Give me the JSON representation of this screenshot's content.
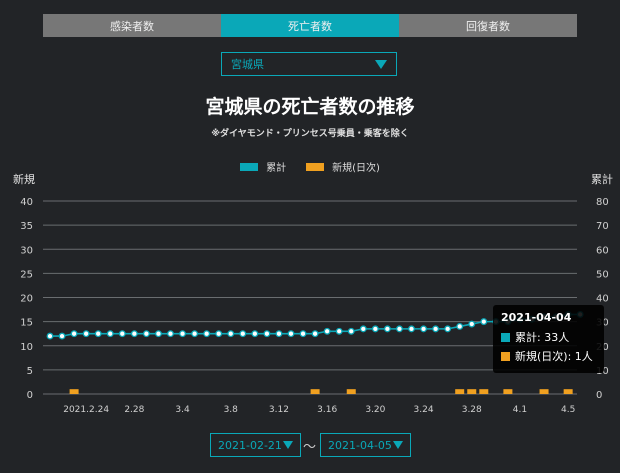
{
  "tabs": [
    {
      "label": "感染者数",
      "active": false
    },
    {
      "label": "死亡者数",
      "active": true
    },
    {
      "label": "回復者数",
      "active": false
    }
  ],
  "prefecture_select": {
    "value": "宮城県"
  },
  "title": "宮城県の死亡者数の推移",
  "subtitle": "※ダイヤモンド・プリンセス号乗員・乗客を除く",
  "legend": [
    {
      "label": "累計",
      "color": "#0aa8b8"
    },
    {
      "label": "新規(日次)",
      "color": "#f0a020"
    }
  ],
  "axis_left_title": "新規",
  "axis_right_title": "累計",
  "tooltip": {
    "date": "2021-04-04",
    "cumulative": "累計: 33人",
    "daily": "新規(日次): 1人"
  },
  "date_range": {
    "start": "2021-02-21",
    "end": "2021-04-05",
    "separator": "〜"
  },
  "chart_data": {
    "type": "line",
    "x_tick_labels": [
      "2021.2.24",
      "2.28",
      "3.4",
      "3.8",
      "3.12",
      "3.16",
      "3.20",
      "3.24",
      "3.28",
      "4.1",
      "4.5"
    ],
    "x_tick_index": [
      3,
      7,
      11,
      15,
      19,
      23,
      27,
      31,
      35,
      39,
      43
    ],
    "y_left": {
      "ticks": [
        0,
        5,
        10,
        15,
        20,
        25,
        30,
        35,
        40
      ],
      "range": [
        0,
        40
      ]
    },
    "y_right": {
      "ticks": [
        0,
        10,
        20,
        30,
        40,
        50,
        60,
        70,
        80
      ],
      "range": [
        0,
        80
      ]
    },
    "start_date": "2021-02-21",
    "series": [
      {
        "name": "累計",
        "axis": "right",
        "kind": "line",
        "color": "#0aa8b8",
        "values": [
          24,
          24,
          25,
          25,
          25,
          25,
          25,
          25,
          25,
          25,
          25,
          25,
          25,
          25,
          25,
          25,
          25,
          25,
          25,
          25,
          25,
          25,
          25,
          26,
          26,
          26,
          27,
          27,
          27,
          27,
          27,
          27,
          27,
          27,
          28,
          29,
          30,
          30,
          30,
          31,
          31,
          32,
          32,
          33,
          33
        ]
      },
      {
        "name": "新規(日次)",
        "axis": "left",
        "kind": "bar",
        "color": "#f0a020",
        "values": [
          0,
          0,
          1,
          0,
          0,
          0,
          0,
          0,
          0,
          0,
          0,
          0,
          0,
          0,
          0,
          0,
          0,
          0,
          0,
          0,
          0,
          0,
          1,
          0,
          0,
          1,
          0,
          0,
          0,
          0,
          0,
          0,
          0,
          0,
          1,
          1,
          1,
          0,
          1,
          0,
          0,
          1,
          0,
          1,
          0
        ]
      }
    ]
  }
}
